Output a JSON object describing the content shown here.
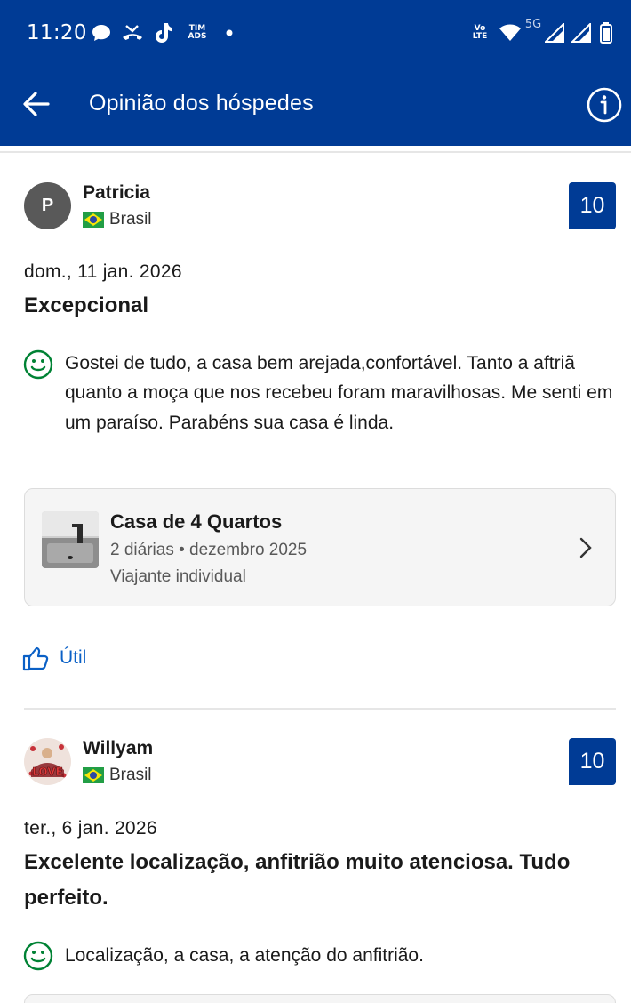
{
  "status_bar": {
    "time": "11:20",
    "carrier_badge": [
      "TIM",
      "ADS"
    ],
    "volte": [
      "Vo",
      "LTE"
    ],
    "network": "5G",
    "icons": [
      "chat-bubble-icon",
      "missed-call-icon",
      "tiktok-icon",
      "tim-ads-icon",
      "dot-icon",
      "volte-icon",
      "wifi-icon",
      "signal-icon",
      "signal-icon",
      "battery-icon"
    ]
  },
  "app_bar": {
    "title": "Opinião dos hóspedes",
    "back_icon": "arrow-left-icon",
    "info_icon": "info-icon"
  },
  "colors": {
    "brand_blue": "#003b95",
    "link_blue": "#0a60c6",
    "positive_green": "#008234"
  },
  "reviews": [
    {
      "avatar_letter": "P",
      "name": "Patricia",
      "country": "Brasil",
      "score": "10",
      "date": "dom., 11 jan. 2026",
      "headline": "Excepcional",
      "positive": "Gostei de tudo, a casa bem arejada,confortável. Tanto a aftriã quanto a moça que nos recebeu foram maravilhosas. Me senti em um paraíso. Parabéns sua casa é linda.",
      "stay": {
        "room": "Casa de 4 Quartos",
        "details": "2 diárias • dezembro 2025",
        "traveler": "Viajante individual"
      },
      "useful_label": "Útil"
    },
    {
      "avatar_text": "LOVE",
      "name": "Willyam",
      "country": "Brasil",
      "score": "10",
      "date": "ter., 6 jan. 2026",
      "headline": "Excelente localização, anfitrião muito atenciosa. Tudo perfeito.",
      "positive": "Localização, a casa, a atenção do anfitrião."
    }
  ]
}
